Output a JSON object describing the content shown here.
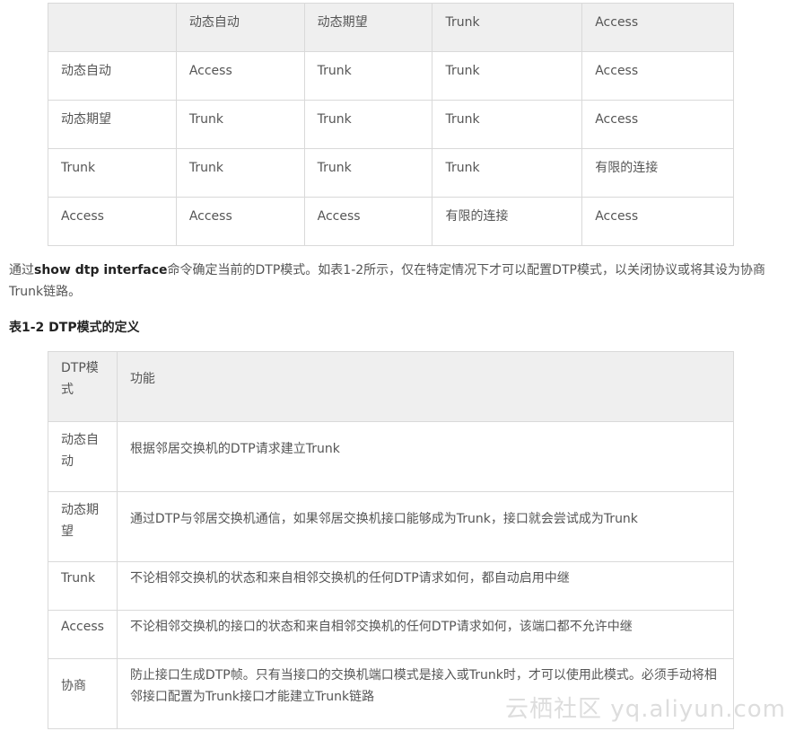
{
  "table1": {
    "header": [
      "",
      "动态自动",
      "动态期望",
      "Trunk",
      "Access"
    ],
    "rows": [
      [
        "动态自动",
        "Access",
        "Trunk",
        "Trunk",
        "Access"
      ],
      [
        "动态期望",
        "Trunk",
        "Trunk",
        "Trunk",
        "Access"
      ],
      [
        "Trunk",
        "Trunk",
        "Trunk",
        "Trunk",
        "有限的连接"
      ],
      [
        "Access",
        "Access",
        "Access",
        "有限的连接",
        "Access"
      ]
    ]
  },
  "paragraph": {
    "prefix": "通过",
    "command": "show dtp interface",
    "suffix": "命令确定当前的DTP模式。如表1-2所示，仅在特定情况下才可以配置DTP模式，以关闭协议或将其设为协商Trunk链路。"
  },
  "caption": "表1-2 DTP模式的定义",
  "table2": {
    "header": [
      "DTP模式",
      "功能"
    ],
    "rows": [
      [
        "动态自动",
        "根据邻居交换机的DTP请求建立Trunk"
      ],
      [
        "动态期望",
        "通过DTP与邻居交换机通信，如果邻居交换机接口能够成为Trunk，接口就会尝试成为Trunk"
      ],
      [
        "Trunk",
        "不论相邻交换机的状态和来自相邻交换机的任何DTP请求如何，都自动启用中继"
      ],
      [
        "Access",
        "不论相邻交换机的接口的状态和来自相邻交换机的任何DTP请求如何，该端口都不允许中继"
      ],
      [
        "协商",
        "防止接口生成DTP帧。只有当接口的交换机端口模式是接入或Trunk时，才可以使用此模式。必须手动将相邻接口配置为Trunk接口才能建立Trunk链路"
      ]
    ]
  },
  "watermark": "云栖社区 yq.aliyun.com"
}
